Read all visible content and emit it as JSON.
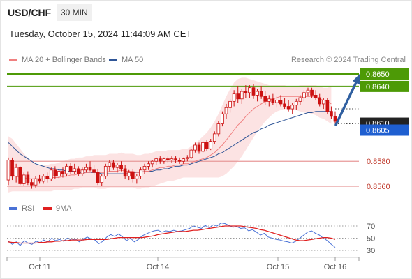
{
  "header": {
    "symbol": "USD/CHF",
    "timeframe": "30 MIN",
    "datetime": "Tuesday, October 15, 2024 11:44:09 AM CET"
  },
  "legend": {
    "ma20_label": "MA 20 + Bollinger Bands",
    "ma50_label": "MA 50",
    "credit": "Research © 2024 Trading Central",
    "rsi_label": "RSI",
    "rsi_ma_label": "9MA"
  },
  "colors": {
    "candle": "#cc1111",
    "ma20": "#f08080",
    "band_fill": "#fcdede",
    "ma50": "#2f5597",
    "resistance": "#4d9a06",
    "current": "#1f5fd0",
    "support": "#e89a9a",
    "arrow": "#2f5fa0",
    "rsi": "#4a72d6",
    "rsi_ma": "#e02020"
  },
  "chart_data": [
    {
      "type": "candlestick",
      "title": "USD/CHF 30 MIN",
      "x_ticks": [
        "Oct 11",
        "Oct 14",
        "Oct 15",
        "Oct 16"
      ],
      "ylim": [
        0.8548,
        0.8656
      ],
      "candles": [
        [
          0.8565,
          0.8583,
          0.8561,
          0.8581
        ],
        [
          0.8581,
          0.8583,
          0.8565,
          0.8568
        ],
        [
          0.8568,
          0.8578,
          0.8563,
          0.8575
        ],
        [
          0.8575,
          0.8576,
          0.8561,
          0.8562
        ],
        [
          0.8562,
          0.8571,
          0.856,
          0.8569
        ],
        [
          0.8569,
          0.8572,
          0.8561,
          0.8563
        ],
        [
          0.8563,
          0.8566,
          0.8558,
          0.8561
        ],
        [
          0.8561,
          0.8568,
          0.8559,
          0.8566
        ],
        [
          0.8566,
          0.8569,
          0.8562,
          0.8564
        ],
        [
          0.8564,
          0.857,
          0.8562,
          0.8568
        ],
        [
          0.8568,
          0.8571,
          0.8563,
          0.8566
        ],
        [
          0.8566,
          0.8575,
          0.8564,
          0.8573
        ],
        [
          0.8573,
          0.8576,
          0.8566,
          0.8568
        ],
        [
          0.8568,
          0.8574,
          0.8566,
          0.8572
        ],
        [
          0.8572,
          0.8575,
          0.8567,
          0.857
        ],
        [
          0.857,
          0.8578,
          0.8568,
          0.8576
        ],
        [
          0.8576,
          0.8579,
          0.857,
          0.8572
        ],
        [
          0.8572,
          0.8578,
          0.857,
          0.8574
        ],
        [
          0.8574,
          0.8576,
          0.8568,
          0.857
        ],
        [
          0.857,
          0.8575,
          0.8568,
          0.8573
        ],
        [
          0.8573,
          0.8578,
          0.8571,
          0.8575
        ],
        [
          0.8575,
          0.858,
          0.8572,
          0.8573
        ],
        [
          0.8573,
          0.8577,
          0.8569,
          0.8571
        ],
        [
          0.8571,
          0.8574,
          0.8561,
          0.8563
        ],
        [
          0.8563,
          0.857,
          0.856,
          0.8568
        ],
        [
          0.8568,
          0.8578,
          0.8566,
          0.8576
        ],
        [
          0.8576,
          0.8581,
          0.8572,
          0.8579
        ],
        [
          0.8579,
          0.8581,
          0.8573,
          0.8575
        ],
        [
          0.8575,
          0.8579,
          0.8571,
          0.8577
        ],
        [
          0.8577,
          0.858,
          0.8572,
          0.8574
        ],
        [
          0.8574,
          0.8577,
          0.8566,
          0.8568
        ],
        [
          0.8568,
          0.8573,
          0.8565,
          0.8571
        ],
        [
          0.8571,
          0.8574,
          0.8563,
          0.8566
        ],
        [
          0.8566,
          0.857,
          0.8562,
          0.8568
        ],
        [
          0.8568,
          0.8575,
          0.8566,
          0.8573
        ],
        [
          0.8573,
          0.8578,
          0.857,
          0.8576
        ],
        [
          0.8576,
          0.858,
          0.8573,
          0.8578
        ],
        [
          0.8578,
          0.8581,
          0.8575,
          0.858
        ],
        [
          0.858,
          0.8583,
          0.8577,
          0.8582
        ],
        [
          0.8582,
          0.8584,
          0.8578,
          0.858
        ],
        [
          0.858,
          0.8583,
          0.8578,
          0.8582
        ],
        [
          0.8582,
          0.8584,
          0.8579,
          0.8581
        ],
        [
          0.8581,
          0.8584,
          0.8579,
          0.8582
        ],
        [
          0.8582,
          0.8584,
          0.8579,
          0.8581
        ],
        [
          0.8581,
          0.8583,
          0.8578,
          0.858
        ],
        [
          0.858,
          0.8583,
          0.8578,
          0.8582
        ],
        [
          0.8582,
          0.8585,
          0.858,
          0.8583
        ],
        [
          0.8583,
          0.859,
          0.8582,
          0.8589
        ],
        [
          0.8589,
          0.8595,
          0.8587,
          0.8593
        ],
        [
          0.8593,
          0.8595,
          0.8586,
          0.8588
        ],
        [
          0.8588,
          0.8596,
          0.8587,
          0.8595
        ],
        [
          0.8595,
          0.8597,
          0.8588,
          0.859
        ],
        [
          0.859,
          0.8598,
          0.8589,
          0.8596
        ],
        [
          0.8596,
          0.8604,
          0.8594,
          0.8602
        ],
        [
          0.8602,
          0.8612,
          0.86,
          0.861
        ],
        [
          0.861,
          0.862,
          0.8608,
          0.8618
        ],
        [
          0.8618,
          0.8626,
          0.8614,
          0.8623
        ],
        [
          0.8623,
          0.863,
          0.8619,
          0.8628
        ],
        [
          0.8628,
          0.8637,
          0.8624,
          0.8634
        ],
        [
          0.8634,
          0.864,
          0.8627,
          0.863
        ],
        [
          0.863,
          0.8638,
          0.8626,
          0.8636
        ],
        [
          0.8636,
          0.8641,
          0.8631,
          0.8635
        ],
        [
          0.8635,
          0.8641,
          0.8631,
          0.8639
        ],
        [
          0.8639,
          0.8642,
          0.863,
          0.8633
        ],
        [
          0.8633,
          0.8638,
          0.8628,
          0.8636
        ],
        [
          0.8636,
          0.864,
          0.863,
          0.8632
        ],
        [
          0.8632,
          0.8636,
          0.8625,
          0.8628
        ],
        [
          0.8628,
          0.8633,
          0.8624,
          0.863
        ],
        [
          0.863,
          0.8634,
          0.8625,
          0.8627
        ],
        [
          0.8627,
          0.8632,
          0.8623,
          0.8629
        ],
        [
          0.8629,
          0.8633,
          0.8624,
          0.8626
        ],
        [
          0.8626,
          0.8631,
          0.8622,
          0.8624
        ],
        [
          0.8624,
          0.8629,
          0.862,
          0.8622
        ],
        [
          0.8622,
          0.8627,
          0.8618,
          0.8625
        ],
        [
          0.8625,
          0.863,
          0.8621,
          0.8628
        ],
        [
          0.8628,
          0.8633,
          0.8625,
          0.8631
        ],
        [
          0.8631,
          0.8637,
          0.8628,
          0.8635
        ],
        [
          0.8635,
          0.8639,
          0.8632,
          0.8637
        ],
        [
          0.8637,
          0.8639,
          0.8631,
          0.8633
        ],
        [
          0.8633,
          0.8637,
          0.8629,
          0.8631
        ],
        [
          0.8631,
          0.8634,
          0.8624,
          0.8626
        ],
        [
          0.8626,
          0.8631,
          0.8622,
          0.8629
        ],
        [
          0.8629,
          0.8631,
          0.8618,
          0.862
        ],
        [
          0.862,
          0.8624,
          0.8614,
          0.8616
        ],
        [
          0.8616,
          0.862,
          0.861,
          0.8612
        ]
      ],
      "ma20": [
        0.8568,
        0.8569,
        0.8568,
        0.8567,
        0.8567,
        0.8566,
        0.8566,
        0.8566,
        0.8566,
        0.8566,
        0.8566,
        0.8567,
        0.8567,
        0.8567,
        0.8568,
        0.8568,
        0.8569,
        0.8569,
        0.857,
        0.857,
        0.8571,
        0.8571,
        0.8572,
        0.8571,
        0.8571,
        0.8571,
        0.8572,
        0.8572,
        0.8572,
        0.8573,
        0.8572,
        0.8572,
        0.8572,
        0.8571,
        0.8571,
        0.8572,
        0.8572,
        0.8573,
        0.8574,
        0.8575,
        0.8575,
        0.8576,
        0.8576,
        0.8577,
        0.8577,
        0.8578,
        0.8578,
        0.8579,
        0.858,
        0.8581,
        0.8582,
        0.8583,
        0.8585,
        0.8587,
        0.859,
        0.8593,
        0.8597,
        0.8601,
        0.8605,
        0.8609,
        0.8612,
        0.8616,
        0.8619,
        0.8622,
        0.8624,
        0.8626,
        0.8628,
        0.8629,
        0.863,
        0.8631,
        0.8632,
        0.8632,
        0.8632,
        0.8632,
        0.8632,
        0.8632,
        0.8632,
        0.8632,
        0.8632,
        0.8631,
        0.863,
        0.8629,
        0.8628,
        0.8626
      ],
      "band_upper": [
        0.86,
        0.8598,
        0.8594,
        0.859,
        0.8586,
        0.8583,
        0.858,
        0.8578,
        0.8577,
        0.8577,
        0.8577,
        0.8578,
        0.8578,
        0.8579,
        0.858,
        0.8581,
        0.8582,
        0.8582,
        0.8583,
        0.8583,
        0.8584,
        0.8584,
        0.8585,
        0.8585,
        0.8585,
        0.8585,
        0.8586,
        0.8586,
        0.8586,
        0.8587,
        0.8586,
        0.8586,
        0.8586,
        0.8585,
        0.8585,
        0.8586,
        0.8586,
        0.8587,
        0.8588,
        0.8588,
        0.8588,
        0.8589,
        0.8589,
        0.8589,
        0.8589,
        0.859,
        0.859,
        0.8592,
        0.8594,
        0.8597,
        0.86,
        0.8603,
        0.8607,
        0.8612,
        0.8618,
        0.8625,
        0.8632,
        0.8638,
        0.8643,
        0.8646,
        0.8647,
        0.8647,
        0.8646,
        0.8645,
        0.8644,
        0.8643,
        0.8642,
        0.8641,
        0.8641,
        0.8641,
        0.8641,
        0.8641,
        0.864,
        0.864,
        0.864,
        0.8641,
        0.8641,
        0.8641,
        0.8641,
        0.8641,
        0.864,
        0.8639,
        0.8639,
        0.864
      ],
      "band_lower": [
        0.8555,
        0.8556,
        0.8556,
        0.8556,
        0.8556,
        0.8556,
        0.8556,
        0.8556,
        0.8556,
        0.8556,
        0.8556,
        0.8556,
        0.8557,
        0.8557,
        0.8557,
        0.8557,
        0.8557,
        0.8558,
        0.8558,
        0.8559,
        0.8559,
        0.8559,
        0.8559,
        0.8558,
        0.8558,
        0.8558,
        0.8559,
        0.8559,
        0.8559,
        0.8559,
        0.8559,
        0.8559,
        0.8559,
        0.8558,
        0.8558,
        0.8559,
        0.8559,
        0.856,
        0.8561,
        0.8562,
        0.8563,
        0.8564,
        0.8564,
        0.8565,
        0.8566,
        0.8567,
        0.8567,
        0.8567,
        0.8567,
        0.8567,
        0.8567,
        0.8567,
        0.8567,
        0.8567,
        0.8567,
        0.8568,
        0.857,
        0.8573,
        0.8576,
        0.858,
        0.8584,
        0.8589,
        0.8594,
        0.8599,
        0.8604,
        0.8608,
        0.8612,
        0.8615,
        0.8618,
        0.862,
        0.8621,
        0.8622,
        0.8622,
        0.8622,
        0.8621,
        0.862,
        0.8619,
        0.8619,
        0.8618,
        0.8617,
        0.8615,
        0.8614,
        0.8612,
        0.861
      ],
      "ma50": [
        0.8595,
        0.8592,
        0.8589,
        0.8586,
        0.8584,
        0.8582,
        0.858,
        0.8578,
        0.8577,
        0.8576,
        0.8575,
        0.8574,
        0.8574,
        0.8573,
        0.8573,
        0.8572,
        0.8572,
        0.8572,
        0.8571,
        0.8571,
        0.8571,
        0.8571,
        0.8571,
        0.8571,
        0.857,
        0.857,
        0.857,
        0.857,
        0.857,
        0.857,
        0.857,
        0.857,
        0.8571,
        0.8571,
        0.8571,
        0.8572,
        0.8572,
        0.8572,
        0.8573,
        0.8573,
        0.8574,
        0.8574,
        0.8575,
        0.8576,
        0.8576,
        0.8577,
        0.8577,
        0.8578,
        0.8579,
        0.858,
        0.8581,
        0.8582,
        0.8583,
        0.8584,
        0.8586,
        0.8587,
        0.8589,
        0.8591,
        0.8593,
        0.8595,
        0.8597,
        0.8599,
        0.8601,
        0.8603,
        0.8604,
        0.8606,
        0.8607,
        0.8609,
        0.861,
        0.8611,
        0.8612,
        0.8613,
        0.8614,
        0.8615,
        0.8616,
        0.8617,
        0.8618,
        0.8619,
        0.8619,
        0.862,
        0.862,
        0.862,
        0.862,
        0.862
      ],
      "levels": {
        "resistance": [
          0.865,
          0.864
        ],
        "current": 0.8605,
        "support": [
          0.858,
          0.856
        ],
        "marker": 0.861,
        "target": 0.865
      },
      "labels": {
        "r1": "0.8650",
        "r2": "0.8640",
        "marker": "0.8610",
        "current": "0.8605",
        "s1": "0.8580",
        "s2": "0.8560"
      }
    },
    {
      "type": "line",
      "title": "RSI",
      "y_ticks": [
        "70",
        "50",
        "30"
      ],
      "ylim": [
        20,
        80
      ],
      "series": [
        {
          "name": "RSI",
          "values": [
            45,
            40,
            44,
            38,
            46,
            42,
            40,
            45,
            43,
            47,
            44,
            50,
            46,
            48,
            45,
            50,
            47,
            49,
            44,
            48,
            52,
            49,
            47,
            41,
            45,
            52,
            56,
            53,
            57,
            52,
            46,
            50,
            44,
            48,
            54,
            57,
            60,
            62,
            63,
            60,
            62,
            61,
            63,
            61,
            62,
            64,
            66,
            70,
            68,
            66,
            71,
            67,
            72,
            70,
            75,
            74,
            71,
            68,
            69,
            66,
            67,
            62,
            64,
            60,
            55,
            58,
            52,
            50,
            48,
            47,
            45,
            44,
            42,
            45,
            50,
            55,
            60,
            62,
            58,
            55,
            50,
            46,
            40,
            35
          ]
        },
        {
          "name": "9MA",
          "values": [
            44,
            43,
            43,
            42,
            42,
            42,
            42,
            42,
            43,
            43,
            44,
            44,
            45,
            45,
            46,
            46,
            47,
            47,
            47,
            47,
            48,
            48,
            48,
            48,
            48,
            48,
            49,
            50,
            51,
            51,
            51,
            51,
            51,
            51,
            51,
            52,
            53,
            54,
            56,
            57,
            58,
            59,
            60,
            61,
            61,
            61,
            62,
            63,
            63,
            64,
            65,
            66,
            67,
            68,
            69,
            70,
            70,
            70,
            70,
            70,
            69,
            68,
            67,
            66,
            64,
            63,
            61,
            59,
            57,
            55,
            53,
            51,
            49,
            47,
            46,
            46,
            47,
            48,
            49,
            50,
            51,
            51,
            50,
            48
          ]
        }
      ]
    }
  ]
}
